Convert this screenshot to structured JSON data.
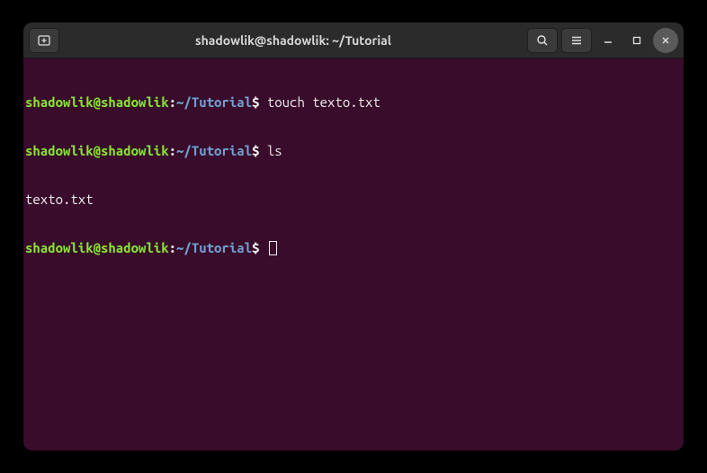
{
  "titlebar": {
    "title": "shadowlik@shadowlik: ~/Tutorial"
  },
  "terminal": {
    "lines": [
      {
        "user": "shadowlik@shadowlik",
        "colon": ":",
        "path": "~/Tutorial",
        "dollar": "$",
        "command": " touch texto.txt"
      },
      {
        "user": "shadowlik@shadowlik",
        "colon": ":",
        "path": "~/Tutorial",
        "dollar": "$",
        "command": " ls"
      },
      {
        "output": "texto.txt"
      },
      {
        "user": "shadowlik@shadowlik",
        "colon": ":",
        "path": "~/Tutorial",
        "dollar": "$",
        "command": " ",
        "cursor": true
      }
    ]
  }
}
